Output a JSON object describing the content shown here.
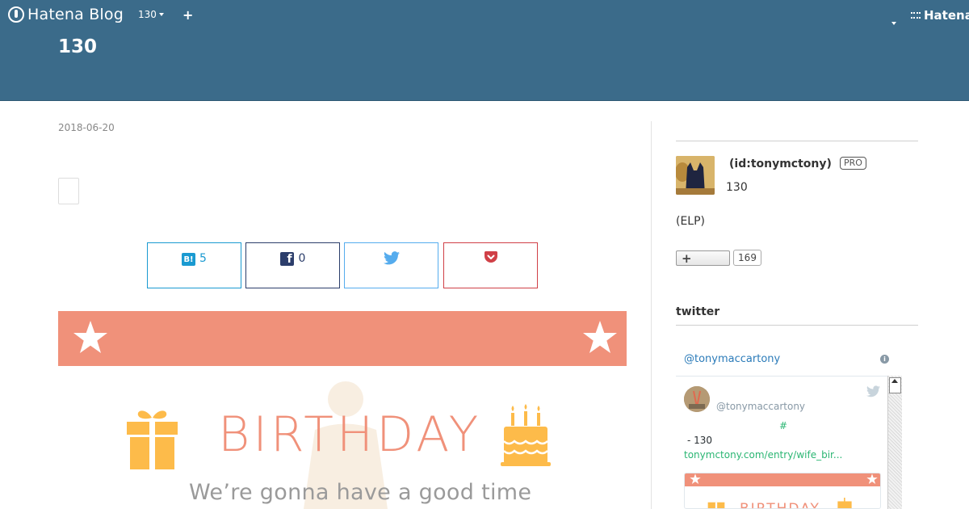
{
  "header": {
    "logo_text": "Hatena Blog",
    "blog_switcher_label": "130",
    "add_button_glyph": "+",
    "brand_right": "Hatena",
    "blog_title": "130"
  },
  "entry": {
    "date": "2018-06-20",
    "share": {
      "hatena_icon_text": "B!",
      "hatena_count": "5",
      "facebook_icon_text": "f",
      "facebook_count": "0"
    },
    "banner": {
      "title": "BIRTHDAY",
      "subtitle": "We’re gonna have a good time"
    }
  },
  "sidebar": {
    "profile": {
      "id_label": "(id:tonymctony)",
      "badge": "PRO",
      "count": "130",
      "description": "(ELP)",
      "subscribe_glyph": "+",
      "subscribers": "169"
    },
    "twitter_module": {
      "title": "twitter",
      "handle": "@tonymaccartony",
      "info_glyph": "i",
      "tweet": {
        "username": "@tonymaccartony",
        "hashtag": "#",
        "text": "- 130",
        "link": "tonymctony.com/entry/wife_bir...",
        "card_title": "BIRTHDAY"
      }
    }
  },
  "colors": {
    "header_bg": "#3b6b8a",
    "banner_coral": "#f0917a",
    "hatena_blue": "#1a9ad1",
    "facebook_navy": "#2c3e6b",
    "twitter_blue": "#55acee",
    "pocket_red": "#d04047",
    "gift_yellow": "#fdbb4a",
    "link_green": "#2bb673"
  },
  "icons": [
    "hatena-logo-icon",
    "caret-down-icon",
    "plus-icon",
    "hatena-bookmark-icon",
    "facebook-icon",
    "twitter-bird-icon",
    "pocket-icon",
    "star-icon",
    "gift-icon",
    "cake-icon",
    "info-icon"
  ]
}
